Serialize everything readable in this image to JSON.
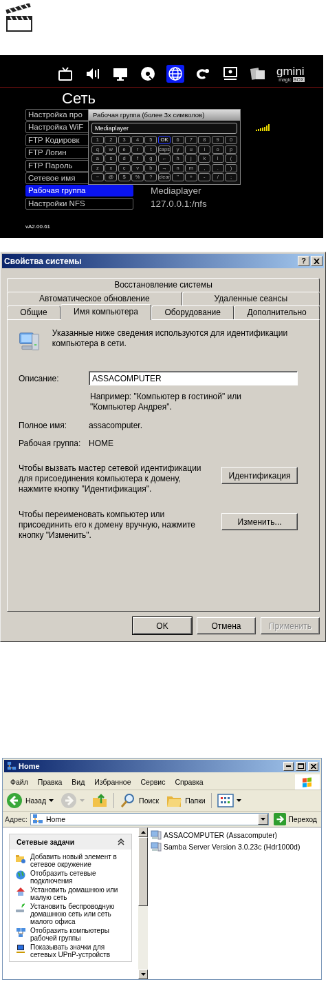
{
  "media_player": {
    "icons": [
      {
        "selected": false
      },
      {
        "selected": false
      },
      {
        "selected": false
      },
      {
        "selected": false
      },
      {
        "selected": true
      },
      {
        "selected": false
      },
      {
        "selected": false
      },
      {
        "selected": false
      }
    ],
    "logo": {
      "text": "gmini",
      "tagline": "magic",
      "badge": "BOX"
    },
    "title": "Сеть",
    "menu": [
      {
        "label": "Настройка про",
        "selected": false,
        "kind": "plain"
      },
      {
        "label": "Настройка WiF",
        "selected": false,
        "kind": "wifi"
      },
      {
        "label": "FTP Кодировк",
        "selected": false,
        "kind": "plain"
      },
      {
        "label": "FTP Логин",
        "selected": false,
        "kind": "plain"
      },
      {
        "label": "FTP Пароль",
        "selected": false,
        "kind": "plain"
      },
      {
        "label": "Сетевое имя",
        "selected": false,
        "kind": "plain"
      },
      {
        "label": "Рабочая группа",
        "selected": true,
        "kind": "plain",
        "value": "Mediaplayer"
      },
      {
        "label": "Настройки NFS",
        "selected": false,
        "kind": "plain",
        "value": "127.0.0.1:/nfs"
      }
    ],
    "keyboard": {
      "title": "Рабочая группа (более 3х символов)",
      "value": "Mediaplayer",
      "keys": [
        [
          {
            "label": "1",
            "selected": false
          },
          {
            "label": "2",
            "selected": false
          },
          {
            "label": "3",
            "selected": false
          },
          {
            "label": "4",
            "selected": false
          },
          {
            "label": "5",
            "selected": false
          },
          {
            "label": "OK",
            "selected": true
          },
          {
            "label": "6",
            "selected": false
          },
          {
            "label": "7",
            "selected": false
          },
          {
            "label": "8",
            "selected": false
          },
          {
            "label": "9",
            "selected": false
          },
          {
            "label": "0",
            "selected": false
          }
        ],
        [
          {
            "label": "q",
            "selected": false
          },
          {
            "label": "w",
            "selected": false
          },
          {
            "label": "e",
            "selected": false
          },
          {
            "label": "r",
            "selected": false
          },
          {
            "label": "t",
            "selected": false
          },
          {
            "label": "caps",
            "selected": false
          },
          {
            "label": "y",
            "selected": false
          },
          {
            "label": "u",
            "selected": false
          },
          {
            "label": "i",
            "selected": false
          },
          {
            "label": "o",
            "selected": false
          },
          {
            "label": "p",
            "selected": false
          }
        ],
        [
          {
            "label": "a",
            "selected": false
          },
          {
            "label": "s",
            "selected": false
          },
          {
            "label": "d",
            "selected": false
          },
          {
            "label": "f",
            "selected": false
          },
          {
            "label": "g",
            "selected": false
          },
          {
            "label": "←",
            "selected": false
          },
          {
            "label": "h",
            "selected": false
          },
          {
            "label": "j",
            "selected": false
          },
          {
            "label": "k",
            "selected": false
          },
          {
            "label": "l",
            "selected": false
          },
          {
            "label": "(",
            "selected": false
          }
        ],
        [
          {
            "label": "z",
            "selected": false
          },
          {
            "label": "x",
            "selected": false
          },
          {
            "label": "c",
            "selected": false
          },
          {
            "label": "v",
            "selected": false
          },
          {
            "label": "b",
            "selected": false
          },
          {
            "label": "→",
            "selected": false
          },
          {
            "label": "n",
            "selected": false
          },
          {
            "label": "m",
            "selected": false
          },
          {
            "label": ",",
            "selected": false
          },
          {
            "label": ".",
            "selected": false
          },
          {
            "label": ")",
            "selected": false
          }
        ],
        [
          {
            "label": "~",
            "selected": false
          },
          {
            "label": "@",
            "selected": false
          },
          {
            "label": "$",
            "selected": false
          },
          {
            "label": "%",
            "selected": false
          },
          {
            "label": "?",
            "selected": false
          },
          {
            "label": "clear",
            "selected": false
          },
          {
            "label": "\"",
            "selected": false
          },
          {
            "label": "+",
            "selected": false
          },
          {
            "label": "-",
            "selected": false
          },
          {
            "label": "/",
            "selected": false
          },
          {
            "label": ";",
            "selected": false
          }
        ]
      ]
    },
    "version": "vA2.00.61"
  },
  "system_properties": {
    "title": "Свойства системы",
    "help": "?",
    "tab_rows": [
      [
        {
          "label": "Восстановление системы",
          "selected": false
        }
      ],
      [
        {
          "label": "Автоматическое обновление",
          "selected": false
        },
        {
          "label": "Удаленные сеансы",
          "selected": false
        }
      ],
      [
        {
          "label": "Общие",
          "selected": false
        },
        {
          "label": "Имя компьютера",
          "selected": true
        },
        {
          "label": "Оборудование",
          "selected": false
        },
        {
          "label": "Дополнительно",
          "selected": false
        }
      ]
    ],
    "intro": "Указанные ниже сведения используются для идентификации компьютера в сети.",
    "description": {
      "label": "Описание:",
      "value": "ASSACOMPUTER"
    },
    "example": "Например: \"Компьютер в гостиной\" или \"Компьютер Андрея\".",
    "fields": [
      {
        "label": "Полное имя:",
        "value": "assacomputer."
      },
      {
        "label": "Рабочая группа:",
        "value": "HOME"
      }
    ],
    "actions": [
      {
        "text": "Чтобы вызвать мастер сетевой идентификации для присоединения компьютера к домену, нажмите кнопку \"Идентификация\".",
        "button": "Идентификация"
      },
      {
        "text": "Чтобы переименовать компьютер или присоединить его к домену вручную, нажмите кнопку \"Изменить\".",
        "button": "Изменить..."
      }
    ],
    "buttons": [
      {
        "label": "OK",
        "default": true,
        "disabled": false
      },
      {
        "label": "Отмена",
        "default": false,
        "disabled": false
      },
      {
        "label": "Применить",
        "default": false,
        "disabled": true
      }
    ]
  },
  "explorer": {
    "title": "Home",
    "menu": [
      "Файл",
      "Правка",
      "Вид",
      "Избранное",
      "Сервис",
      "Справка"
    ],
    "toolbar": [
      {
        "kind": "back",
        "label": "Назад",
        "disabled": false,
        "dropdown": true
      },
      {
        "kind": "forward",
        "disabled": true,
        "dropdown": true
      },
      {
        "kind": "up",
        "disabled": false,
        "dropdown": false
      },
      {
        "kind": "separator"
      },
      {
        "kind": "search",
        "label": "Поиск",
        "disabled": false,
        "dropdown": false
      },
      {
        "kind": "folders",
        "label": "Папки",
        "disabled": false,
        "dropdown": false
      },
      {
        "kind": "separator"
      },
      {
        "kind": "views",
        "disabled": false,
        "dropdown": true
      }
    ],
    "address": {
      "label": "Адрес:",
      "value": "Home",
      "go": "Переход"
    },
    "tasks": {
      "title": "Сетевые задачи",
      "expanded": true,
      "items": [
        "Добавить новый элемент в сетевое окружение",
        "Отобразить сетевые подключения",
        "Установить домашнюю или малую сеть",
        "Установить беспроводную домашнюю сеть или сеть малого офиса",
        "Отобразить компьютеры рабочей группы",
        "Показывать значки для сетевых UPnP-устройств"
      ]
    },
    "items": [
      "ASSACOMPUTER (Assacomputer)",
      "Samba Server Version 3.0.23c (Hdr1000d)"
    ]
  }
}
